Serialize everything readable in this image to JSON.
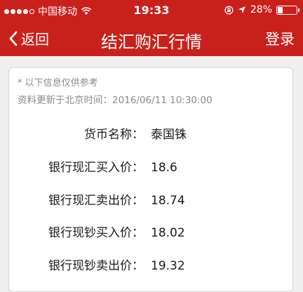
{
  "status_bar": {
    "carrier": "中国移动",
    "wifi_icon": "wifi-icon",
    "time": "19:33",
    "lock_icon": "orientation-lock-icon",
    "location_icon": "location-arrow-icon",
    "battery_percent": "28%",
    "battery_level": 0.28
  },
  "nav": {
    "back_label": "返回",
    "back_icon": "chevron-left-icon",
    "title": "结汇购汇行情",
    "login_label": "登录"
  },
  "info": {
    "note": "* 以下信息仅供参考",
    "update_label": "资料更新于北京时间：",
    "update_time": "2016/06/11 10:30:00"
  },
  "rates": [
    {
      "label": "货币名称：",
      "value": "泰国铢"
    },
    {
      "label": "银行现汇买入价：",
      "value": "18.6"
    },
    {
      "label": "银行现汇卖出价：",
      "value": "18.74"
    },
    {
      "label": "银行现钞买入价：",
      "value": "18.02"
    },
    {
      "label": "银行现钞卖出价：",
      "value": "19.32"
    }
  ],
  "colors": {
    "header_red": "#c8211c",
    "background": "#efefef"
  }
}
